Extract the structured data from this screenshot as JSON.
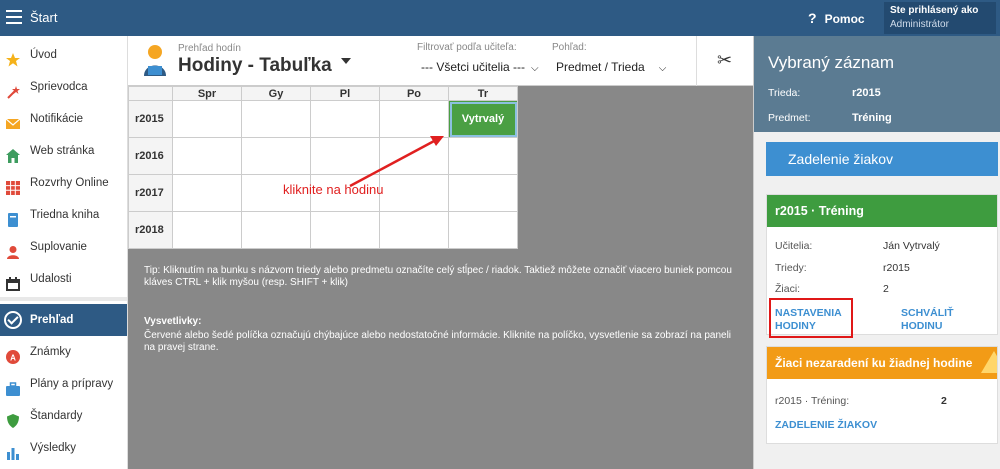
{
  "topbar": {
    "app_title": "Štart",
    "help_label": "Pomoc",
    "help_icon": "?",
    "user_line1": "Ste prihlásený ako",
    "user_line2": "Administrátor"
  },
  "sidebar": {
    "items": [
      {
        "label": "Úvod",
        "icon": "star-icon",
        "color": "#f5b21a"
      },
      {
        "label": "Sprievodca",
        "icon": "wand-icon",
        "color": "#e0493a"
      },
      {
        "label": "Notifikácie",
        "icon": "envelope-icon",
        "color": "#f5a623"
      },
      {
        "label": "Web stránka",
        "icon": "home-icon",
        "color": "#3e9c5f"
      },
      {
        "label": "Rozvrhy Online",
        "icon": "timetable-icon",
        "color": "#e04a3a"
      },
      {
        "label": "Triedna kniha",
        "icon": "book-icon",
        "color": "#3d8fd1"
      },
      {
        "label": "Suplovanie",
        "icon": "substitute-icon",
        "color": "#e04a3a"
      },
      {
        "label": "Udalosti",
        "icon": "calendar-icon",
        "color": "#333333"
      },
      {
        "label": "Prehľad",
        "icon": "check-icon",
        "color": "#ffffff"
      },
      {
        "label": "Známky",
        "icon": "grade-icon",
        "color": "#e04a3a"
      },
      {
        "label": "Plány a prípravy",
        "icon": "briefcase-icon",
        "color": "#3d8fd1"
      },
      {
        "label": "Štandardy",
        "icon": "shield-icon",
        "color": "#3e9c3f"
      },
      {
        "label": "Výsledky",
        "icon": "bar-chart-icon",
        "color": "#3d8fd1"
      }
    ]
  },
  "main": {
    "header_label": "Prehľad hodín",
    "header_title": "Hodiny - Tabuľka",
    "filter_label": "Filtrovať podľa učiteľa:",
    "filter_value": "--- Všetci učitelia ---",
    "view_label": "Pohľad:",
    "view_value": "Predmet / Trieda",
    "columns": [
      "Spr",
      "Gy",
      "Pl",
      "Po",
      "Tr"
    ],
    "rows": [
      {
        "label": "r2015",
        "cells": [
          "",
          "",
          "",
          "",
          "Vytrvalý"
        ]
      },
      {
        "label": "r2016",
        "cells": [
          "",
          "",
          "",
          "",
          ""
        ]
      },
      {
        "label": "r2017",
        "cells": [
          "",
          "",
          "",
          "",
          ""
        ]
      },
      {
        "label": "r2018",
        "cells": [
          "",
          "",
          "",
          "",
          ""
        ]
      }
    ],
    "annotation": "kliknite na hodinu",
    "tip": "Tip: Kliknutím na bunku s názvom triedy alebo predmetu označíte celý stĺpec / riadok. Taktiež môžete označiť viacero buniek pomcou kláves CTRL + klik myšou (resp. SHIFT + klik)",
    "legend_title": "Vysvetlivky:",
    "legend_text": "Červené alebo šedé políčka označujú chýbajúce alebo nedostatočné informácie. Kliknite na políčko, vysvetlenie sa zobrazí na paneli na pravej strane."
  },
  "right": {
    "title": "Vybraný záznam",
    "class_key": "Trieda:",
    "class_value": "r2015",
    "subject_key": "Predmet:",
    "subject_value": "Tréning",
    "assign_button": "Zadelenie žiakov",
    "card1": {
      "title": "r2015 · Tréning",
      "teachers_key": "Učitelia:",
      "teachers_value": "Ján Vytrvalý",
      "classes_key": "Triedy:",
      "classes_value": "r2015",
      "students_key": "Žiaci:",
      "students_value": "2",
      "settings_link": "NASTAVENIA HODINY",
      "approve_link": "SCHVÁLIŤ HODINU"
    },
    "card2": {
      "title": "Žiaci nezaradení ku žiadnej hodine",
      "row_label": "r2015 · Tréning:",
      "row_value": "2",
      "link": "ZADELENIE ŽIAKOV"
    }
  },
  "colors": {
    "topbar": "#2e5a84",
    "lesson_green": "#4a9f43",
    "accent_blue": "#3d8fd1",
    "warning_orange": "#f29b16",
    "annotation_red": "#e02020"
  }
}
